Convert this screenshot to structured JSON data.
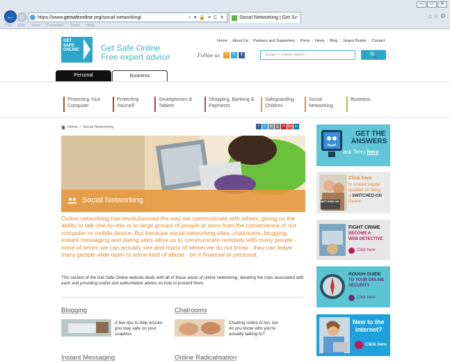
{
  "browser": {
    "url_prefix": "https://www.",
    "url_domain": "getsafeonline.org",
    "url_path": "/social-networking/",
    "addr_icons": "⌕ ▾ 🔒 ≡ C ✕",
    "tab_title": "Social Networking | Get Saf...",
    "tab_close": "×",
    "menu": [
      "File",
      "Edit",
      "View",
      "Favorites",
      "Tools",
      "Help"
    ],
    "window_buttons": [
      "—",
      "□",
      "✕"
    ]
  },
  "utility_nav": [
    "Home",
    "About Us",
    "Partners and Supporters",
    "Press",
    "News",
    "Blog",
    "Jargon Buster",
    "Contact"
  ],
  "logo": {
    "box_text": "GET SAFE ONLINE",
    "title": "Get Safe Online",
    "subtitle": "Free expert advice"
  },
  "follow": {
    "label": "Follow us"
  },
  "search": {
    "placeholder": "Google™ Custom Search",
    "button": "🔍"
  },
  "audience_tabs": {
    "personal": "Personal",
    "business": "Business"
  },
  "categories": [
    {
      "label": "Protecting Your Computer",
      "color": "#8d5a3b"
    },
    {
      "label": "Protecting Yourself",
      "color": "#c0392b"
    },
    {
      "label": "Smartphones & Tablets",
      "color": "#a23b52"
    },
    {
      "label": "Shopping, Banking & Payments",
      "color": "#b8476b"
    },
    {
      "label": "Safeguarding Children",
      "color": "#d9a441"
    },
    {
      "label": "Social Networking",
      "color": "#e38a2e"
    },
    {
      "label": "Business",
      "color": "#a3b84a"
    }
  ],
  "breadcrumb": {
    "home": "Home",
    "separator": "/",
    "current": "Social Networking"
  },
  "share_icons": [
    "f",
    "t",
    "✉",
    "⎙",
    "P",
    "G+",
    "in"
  ],
  "hero": {
    "title": "Social Networking"
  },
  "intro": "Online networking has revolutionised the way we communicate with others, giving us the ability to talk one-to-one or to large groups of people at once from the convenience of our computer or mobile device. But because social networking sites, chatrooms, blogging, instant messaging and dating sites allow us to communicate remotely with many people - none of whom we can actually see and many of whom we do not know - they can leave many people wide open to some kind of abuse - be it financial or personal.",
  "description": "This section of the Get Safe Online website deals with all of these areas of online networking, detailing the risks associated with each and providing useful and authoritative advice on how to prevent them.",
  "sections": [
    {
      "title": "Blogging",
      "text": "A few tips to help ensure you stay safe on your soapbox."
    },
    {
      "title": "Chatrooms",
      "text": "Chatting online is fun, but do you know who you're actually talking to?"
    },
    {
      "title": "Instant Messaging"
    },
    {
      "title": "Online Radicalisation"
    }
  ],
  "sidebar": {
    "answers": {
      "line1": "GET THE",
      "line2": "ANSWERS",
      "line3a": "ask Terry ",
      "line3b": "here"
    },
    "switched_on": {
      "click": "Click here",
      "line2": "to receive regular",
      "line3": "updates on being",
      "line4a": "a ",
      "line4b": "SWITCHED-ON",
      "line5": "Parent",
      "badge": "SWITCHED ON"
    },
    "fight_crime": {
      "line1": "FIGHT CRIME",
      "line2": "BECOME A",
      "line3": "WEB DETECTIVE",
      "cta": "Click here"
    },
    "rough_guide": {
      "line1": "ROUGH GUIDE",
      "line2": "TO YOUR ONLINE",
      "line3": "SECURITY",
      "cta": "Click here"
    },
    "new_internet": {
      "line1": "New to the",
      "line2": "internet?",
      "cta": "Click here"
    }
  },
  "colors": {
    "brand": "#2ba8c9",
    "orange": "#e08a2c",
    "teal_banner": "#5ec6d6"
  }
}
